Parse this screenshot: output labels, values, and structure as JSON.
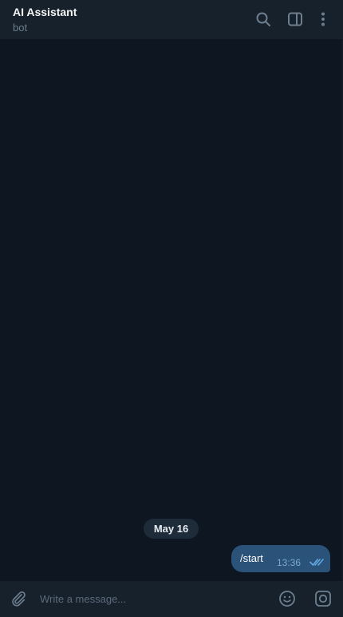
{
  "header": {
    "title": "AI Assistant",
    "subtitle": "bot",
    "icons": [
      "search-icon",
      "sidebar-toggle-icon",
      "more-vertical-icon"
    ]
  },
  "messages": {
    "date_separator": "May 16",
    "items": [
      {
        "text": "/start",
        "time": "13:36",
        "outgoing": true,
        "status": "read"
      }
    ]
  },
  "composer": {
    "placeholder": "Write a message...",
    "value": "",
    "icons": [
      "attach-icon",
      "emoji-icon",
      "camera-icon"
    ]
  },
  "colors": {
    "background": "#0e1621",
    "header": "#17212b",
    "bubble_outgoing": "#2b5278",
    "accent": "#5fa8e0",
    "icon": "#6d7f8f"
  }
}
